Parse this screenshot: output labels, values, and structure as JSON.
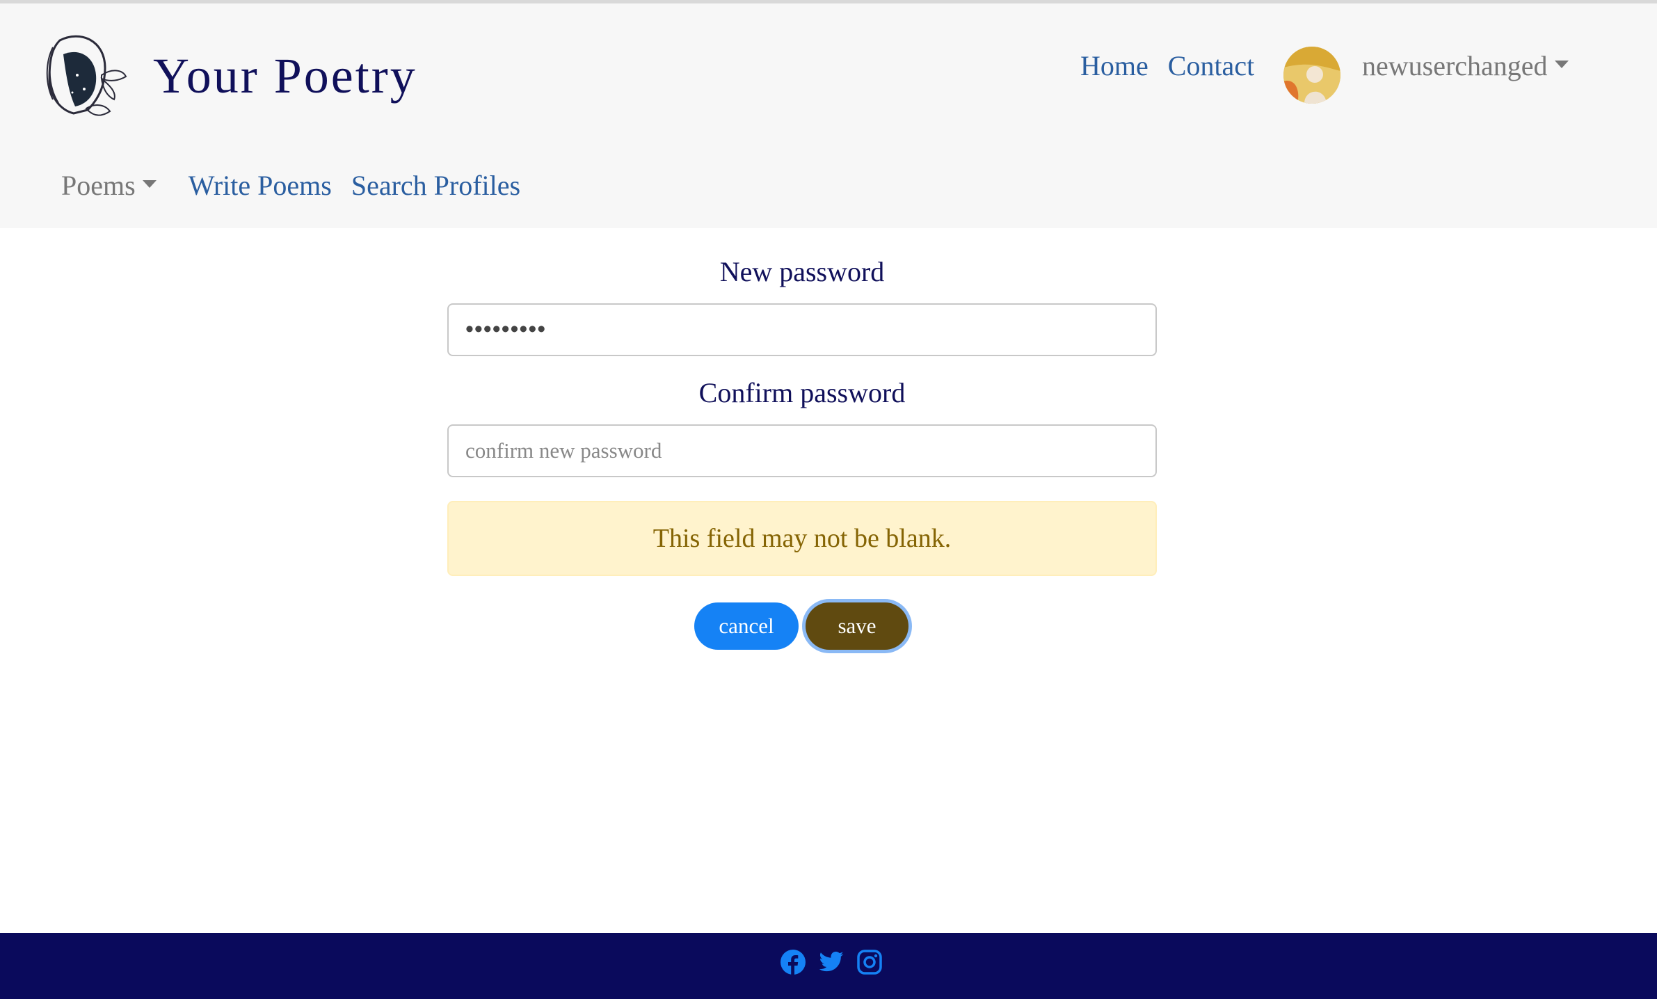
{
  "brand": {
    "title": "Your Poetry"
  },
  "top_nav": {
    "home": "Home",
    "contact": "Contact",
    "username": "newuserchanged"
  },
  "sub_nav": {
    "poems": "Poems",
    "write": "Write Poems",
    "search": "Search Profiles"
  },
  "form": {
    "new_password_label": "New password",
    "new_password_value": "•••••••••",
    "confirm_password_label": "Confirm password",
    "confirm_placeholder": "confirm new password",
    "alert_text": "This field may not be blank.",
    "cancel_label": "cancel",
    "save_label": "save"
  },
  "colors": {
    "brand_navy": "#10105a",
    "link_blue": "#2a5ea0",
    "primary_button": "#1582f5",
    "save_button": "#604a10",
    "alert_bg": "#fff3cd",
    "footer_bg": "#0a0a5c",
    "social_icon": "#1582f5"
  },
  "footer": {
    "icons": [
      "facebook-icon",
      "twitter-icon",
      "instagram-icon"
    ]
  }
}
